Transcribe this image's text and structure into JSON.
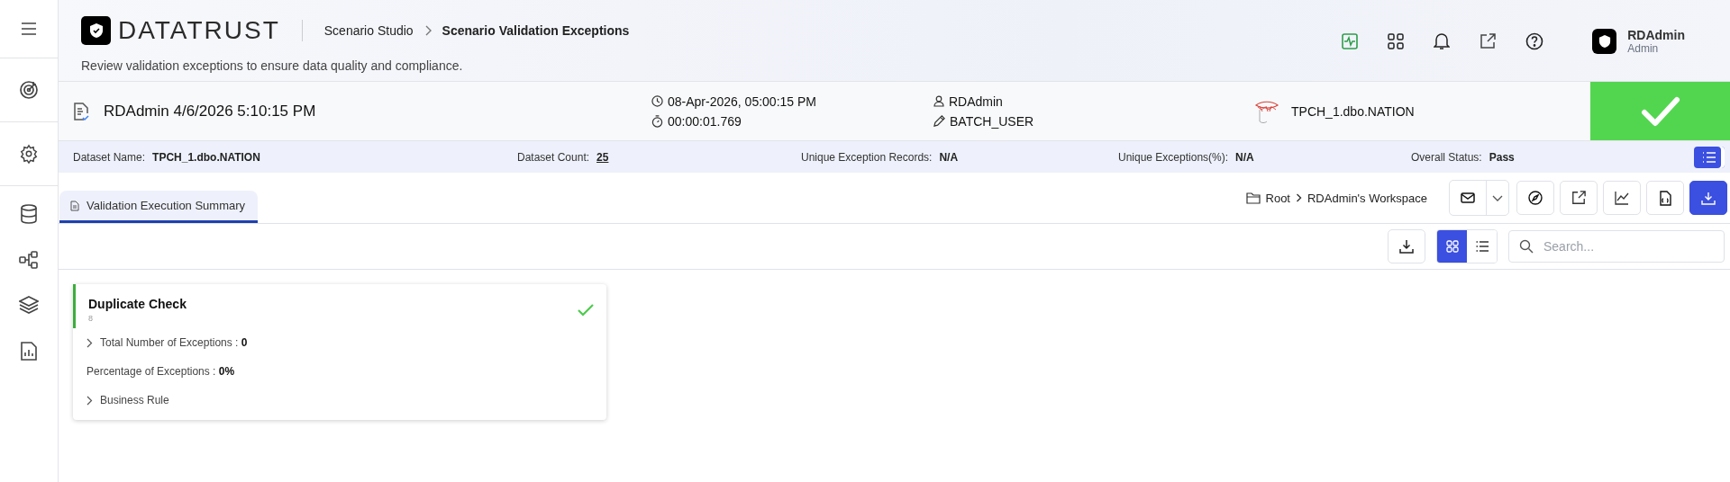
{
  "header": {
    "logo": "DATATRUST",
    "breadcrumb": [
      {
        "label": "Scenario Studio"
      },
      {
        "label": "Scenario Validation Exceptions"
      }
    ],
    "subtitle": "Review validation exceptions to ensure data quality and compliance.",
    "user": {
      "name": "RDAdmin",
      "role": "Admin"
    }
  },
  "run": {
    "title": "RDAdmin 4/6/2026 5:10:15 PM",
    "started": "08-Apr-2026, 05:00:15 PM",
    "duration": "00:00:01.769",
    "owner": "RDAdmin",
    "editor": "BATCH_USER",
    "source": "TPCH_1.dbo.NATION",
    "passed": true
  },
  "summary": [
    {
      "label": "Dataset Name:",
      "value": "TPCH_1.dbo.NATION",
      "link": false
    },
    {
      "label": "Dataset Count:",
      "value": "25",
      "link": true
    },
    {
      "label": "Unique Exception Records:",
      "value": "N/A",
      "link": false
    },
    {
      "label": "Unique Exceptions(%):",
      "value": "N/A",
      "link": false
    },
    {
      "label": "Overall Status:",
      "value": "Pass",
      "link": false
    }
  ],
  "tabs": [
    {
      "label": "Validation Execution Summary",
      "selected": true
    }
  ],
  "location": {
    "root": "Root",
    "workspace": "RDAdmin's Workspace"
  },
  "views": [
    {
      "kind": "grid",
      "selected": true
    },
    {
      "kind": "list",
      "selected": false
    }
  ],
  "search": {
    "placeholder": "Search..."
  },
  "checks": [
    {
      "name": "Duplicate Check",
      "count": "8",
      "passed": true,
      "rows": [
        {
          "text": "Total Number of Exceptions : **0**",
          "expandable": true
        },
        {
          "text": "Percentage of Exceptions : **0%**",
          "expandable": false
        },
        {
          "text": "Business Rule",
          "expandable": true
        }
      ]
    }
  ]
}
